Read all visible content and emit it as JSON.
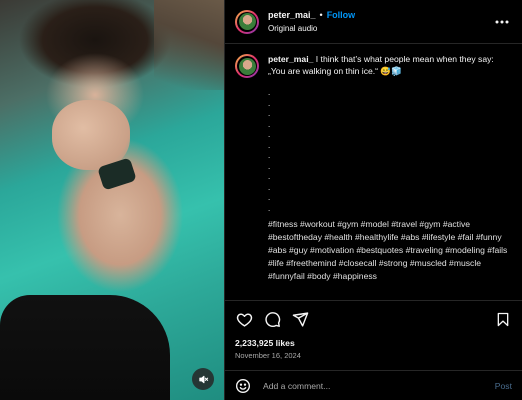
{
  "post": {
    "username": "peter_mai_",
    "follow_label": "Follow",
    "separator": "•",
    "audio_label": "Original audio",
    "caption_text": "I think that’s what people mean when they say: „You are walking on thin ice.“ 😅🧊",
    "caption_dots": [
      ".",
      ".",
      ".",
      ".",
      ".",
      ".",
      ".",
      ".",
      ".",
      ".",
      ".",
      "."
    ],
    "hashtags": "#fitness #workout #gym #model #travel #gym #active #bestoftheday #health #healthylife #abs #lifestyle #fail #funny #abs #guy #motivation #bestquotes #traveling #modeling #fails #life #freethemind #closecall #strong #muscled #muscle #funnyfail #body #happiness",
    "likes": "2,233,925 likes",
    "date": "November 16, 2024"
  },
  "comment": {
    "placeholder": "Add a comment...",
    "post_label": "Post"
  },
  "icons": {
    "more": "more-options-icon",
    "like": "heart-icon",
    "comment": "comment-icon",
    "share": "share-icon",
    "save": "bookmark-icon",
    "emoji": "emoji-icon",
    "mute": "speaker-muted-icon"
  },
  "colors": {
    "accent": "#0095f6",
    "background": "#000000",
    "divider": "#262626",
    "muted_text": "#a8a8a8"
  }
}
